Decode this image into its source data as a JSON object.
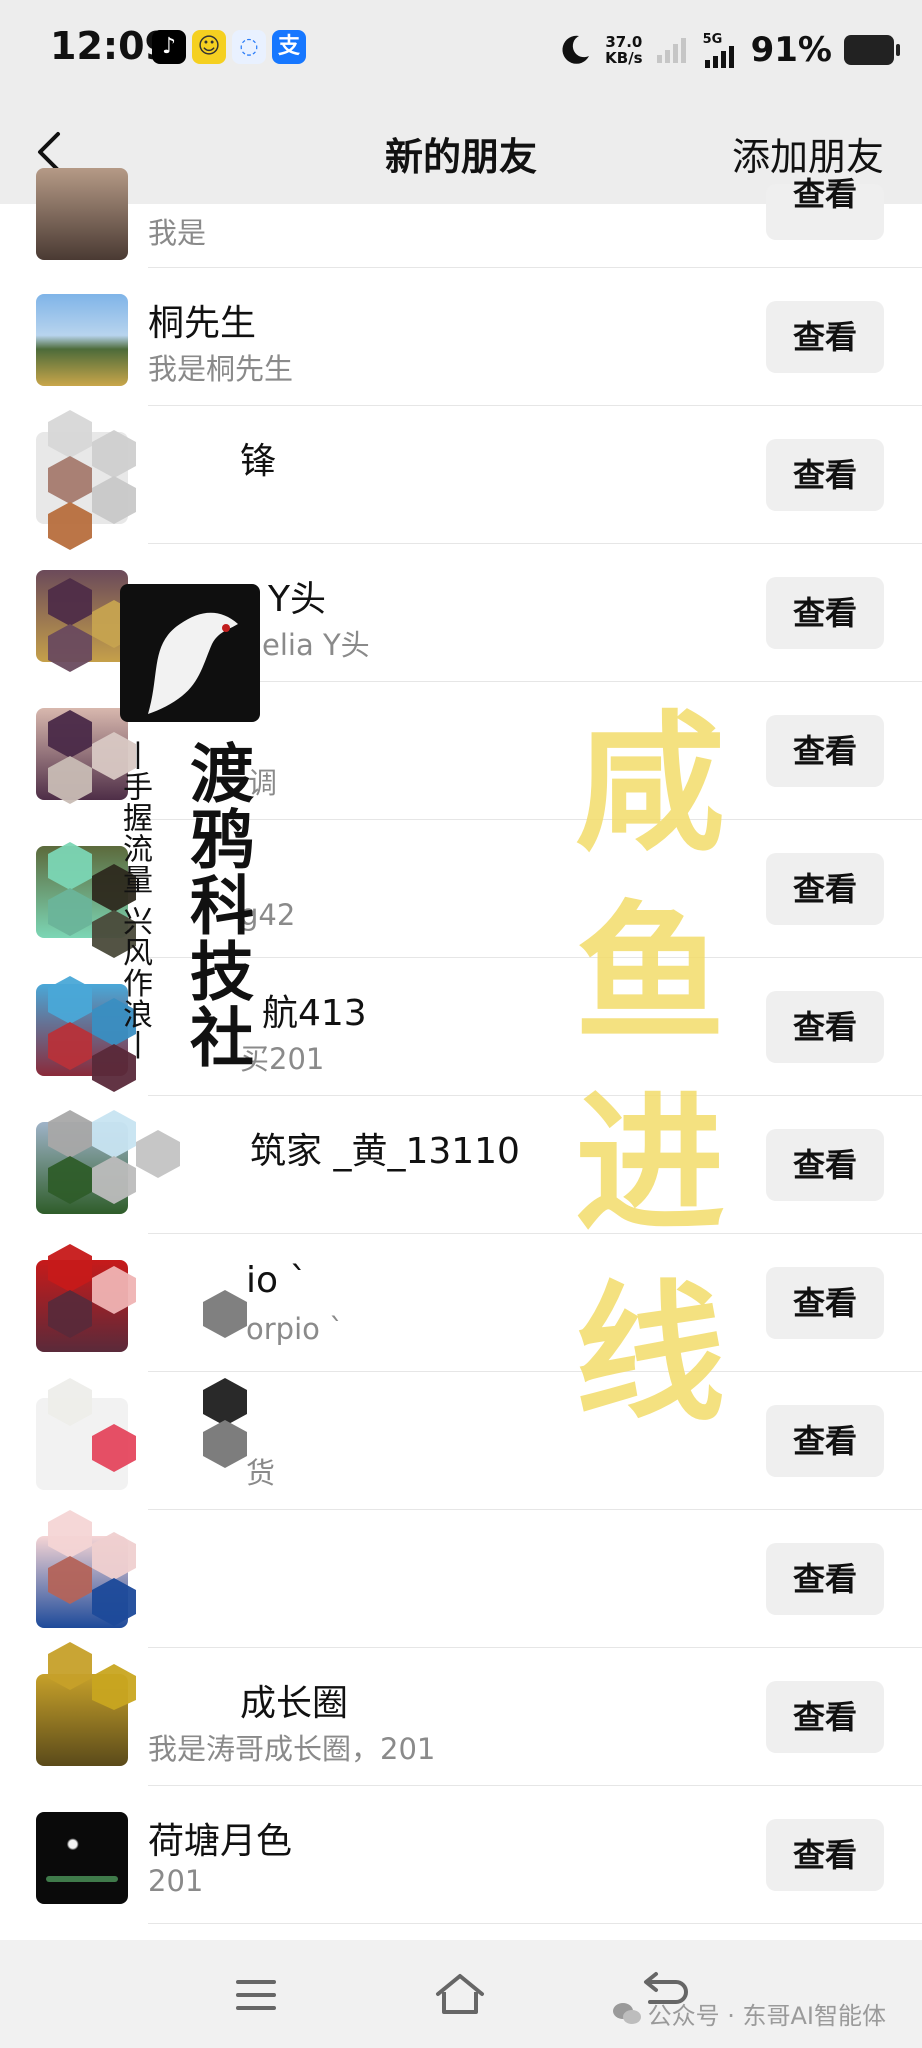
{
  "status_bar": {
    "time": "12:09",
    "speed_value": "37.0",
    "speed_unit": "KB/s",
    "net_type": "5G",
    "battery": "91%"
  },
  "nav": {
    "title": "新的朋友",
    "add_friend": "添加朋友"
  },
  "list": {
    "button_label": "查看",
    "items": [
      {
        "name": "",
        "sub": "我是"
      },
      {
        "name": "桐先生",
        "sub": "我是桐先生"
      },
      {
        "name": "锋",
        "sub": ""
      },
      {
        "name": "Y头",
        "sub": "elia Y头"
      },
      {
        "name": "",
        "sub": "调"
      },
      {
        "name": "",
        "sub": "g42"
      },
      {
        "name": "航413",
        "sub": "买201"
      },
      {
        "name": "筑家 _黄_13110",
        "sub": ""
      },
      {
        "name": "io `",
        "sub": "orpio `"
      },
      {
        "name": "",
        "sub": "货"
      },
      {
        "name": "",
        "sub": ""
      },
      {
        "name": "成长圈",
        "sub": "我是涛哥成长圈，201"
      },
      {
        "name": "荷塘月色",
        "sub": "201"
      }
    ]
  },
  "overlay": {
    "yellow_text": [
      "咸",
      "鱼",
      "进",
      "线"
    ],
    "brand_name": "渡鸦科技社",
    "brand_slogan": "丨手握流量 兴风作浪丨"
  },
  "footer": {
    "credit": "公众号 · 东哥AI智能体"
  }
}
